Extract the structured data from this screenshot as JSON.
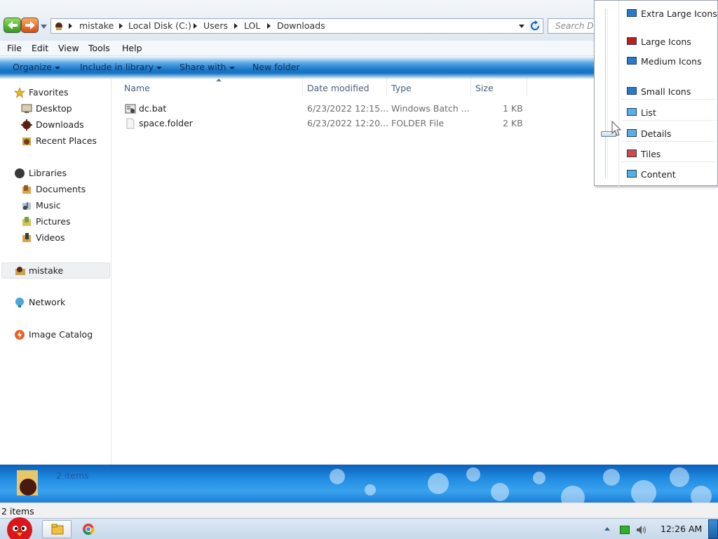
{
  "address": {
    "crumbs": [
      "mistake",
      "Local Disk (C:)",
      "Users",
      "LOL",
      "Downloads"
    ],
    "search_placeholder": "Search Downloads"
  },
  "menu": [
    "File",
    "Edit",
    "View",
    "Tools",
    "Help"
  ],
  "toolbar": {
    "organize": "Organize",
    "include_in_library": "Include in library",
    "share_with": "Share with",
    "new_folder": "New folder"
  },
  "nav": {
    "favorites": "Favorites",
    "desktop": "Desktop",
    "downloads": "Downloads",
    "recent_places": "Recent Places",
    "libraries": "Libraries",
    "documents": "Documents",
    "music": "Music",
    "pictures": "Pictures",
    "videos": "Videos",
    "mistake": "mistake",
    "network": "Network",
    "image_catalog": "Image Catalog"
  },
  "columns": {
    "name": "Name",
    "date_modified": "Date modified",
    "type": "Type",
    "size": "Size"
  },
  "files": [
    {
      "name": "dc.bat",
      "date": "6/23/2022 12:15...",
      "type": "Windows Batch ...",
      "size": "1 KB"
    },
    {
      "name": "space.folder",
      "date": "6/23/2022 12:20...",
      "type": "FOLDER File",
      "size": "2 KB"
    }
  ],
  "details": {
    "count": "2 items"
  },
  "status": {
    "text": "2 items"
  },
  "taskbar": {
    "clock": "12:26 AM"
  },
  "view_menu": {
    "options": [
      "Extra Large Icons",
      "Large Icons",
      "Medium Icons",
      "Small Icons",
      "List",
      "Details",
      "Tiles",
      "Content"
    ],
    "selected": "Details"
  },
  "colors": {
    "toolbar_blue": "#1a78c9",
    "details_blue": "#1f8ae0",
    "tray_network": "#2fb12f"
  }
}
